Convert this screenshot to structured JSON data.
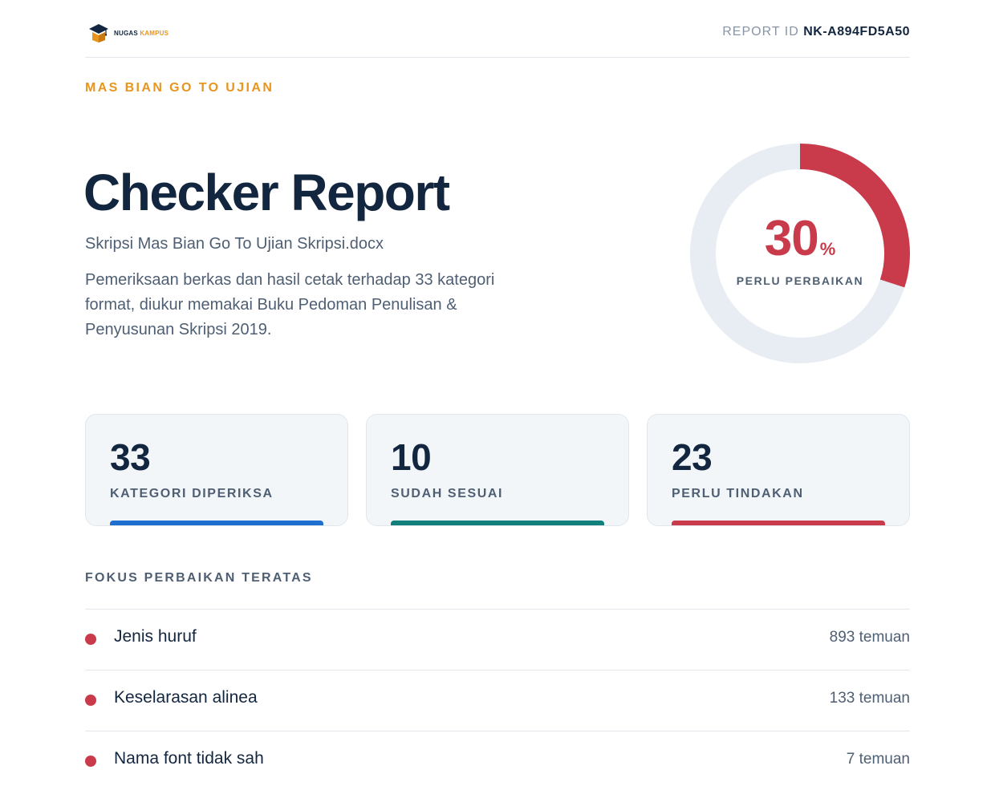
{
  "header": {
    "logo": {
      "name": "NUGAS",
      "accent": "KAMPUS",
      "icon": "graduation-cap-box-icon"
    },
    "report_id_label": "REPORT ID",
    "report_id_value": "NK-A894FD5A50"
  },
  "eyebrow": "MAS BIAN GO TO UJIAN",
  "title": "Checker Report",
  "filename": "Skripsi Mas Bian Go To Ujian Skripsi.docx",
  "description": "Pemeriksaan berkas dan hasil cetak terhadap 33 kategori format, diukur memakai Buku Pedoman Penulisan & Penyusunan Skripsi 2019.",
  "score": {
    "value": "30",
    "unit": "%",
    "fraction": 0.3,
    "label": "PERLU PERBAIKAN",
    "color": "#c93a4a",
    "track_color": "#e8edf3"
  },
  "stats": [
    {
      "value": "33",
      "label": "KATEGORI DIPERIKSA",
      "color": "#1f6fd1"
    },
    {
      "value": "10",
      "label": "SUDAH SESUAI",
      "color": "#12807a"
    },
    {
      "value": "23",
      "label": "PERLU TINDAKAN",
      "color": "#c93a4a"
    }
  ],
  "focus": {
    "title": "FOKUS PERBAIKAN TERATAS",
    "items": [
      {
        "name": "Jenis huruf",
        "count": "893 temuan"
      },
      {
        "name": "Keselarasan alinea",
        "count": "133 temuan"
      },
      {
        "name": "Nama font tidak sah",
        "count": "7 temuan"
      }
    ]
  }
}
